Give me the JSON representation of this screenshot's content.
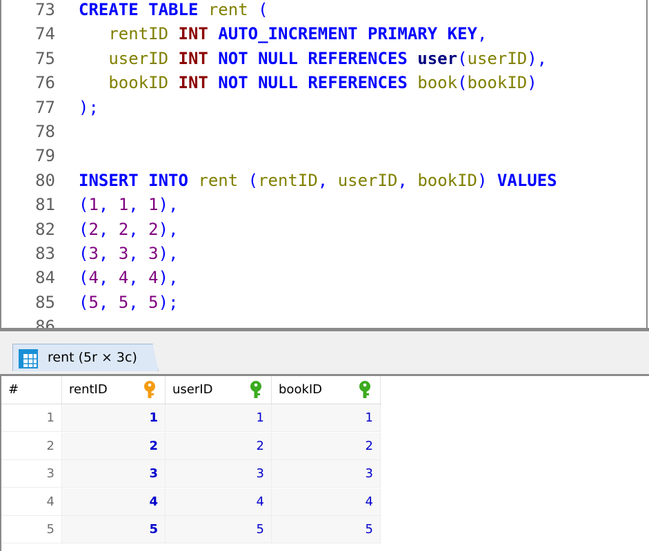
{
  "editor": {
    "lines": [
      {
        "num": "73",
        "tokens": [
          {
            "t": "CREATE TABLE ",
            "c": "kw"
          },
          {
            "t": "rent ",
            "c": "ident"
          },
          {
            "t": "(",
            "c": "sym"
          }
        ]
      },
      {
        "num": "74",
        "tokens": [
          {
            "t": "   rentID ",
            "c": "ident"
          },
          {
            "t": "INT ",
            "c": "kw-type"
          },
          {
            "t": "AUTO_INCREMENT PRIMARY KEY",
            "c": "kw"
          },
          {
            "t": ",",
            "c": "sym"
          }
        ]
      },
      {
        "num": "75",
        "tokens": [
          {
            "t": "   userID ",
            "c": "ident"
          },
          {
            "t": "INT ",
            "c": "kw-type"
          },
          {
            "t": "NOT NULL REFERENCES ",
            "c": "kw"
          },
          {
            "t": "user",
            "c": "fn"
          },
          {
            "t": "(",
            "c": "sym"
          },
          {
            "t": "userID",
            "c": "ident"
          },
          {
            "t": "),",
            "c": "sym"
          }
        ]
      },
      {
        "num": "76",
        "tokens": [
          {
            "t": "   bookID ",
            "c": "ident"
          },
          {
            "t": "INT ",
            "c": "kw-type"
          },
          {
            "t": "NOT NULL REFERENCES ",
            "c": "kw"
          },
          {
            "t": "book",
            "c": "ident"
          },
          {
            "t": "(",
            "c": "sym"
          },
          {
            "t": "bookID",
            "c": "ident"
          },
          {
            "t": ")",
            "c": "sym"
          }
        ]
      },
      {
        "num": "77",
        "tokens": [
          {
            "t": ");",
            "c": "sym"
          }
        ]
      },
      {
        "num": "78",
        "tokens": []
      },
      {
        "num": "79",
        "tokens": []
      },
      {
        "num": "80",
        "tokens": [
          {
            "t": "INSERT INTO ",
            "c": "kw"
          },
          {
            "t": "rent ",
            "c": "ident"
          },
          {
            "t": "(",
            "c": "sym"
          },
          {
            "t": "rentID",
            "c": "ident"
          },
          {
            "t": ", ",
            "c": "sym"
          },
          {
            "t": "userID",
            "c": "ident"
          },
          {
            "t": ", ",
            "c": "sym"
          },
          {
            "t": "bookID",
            "c": "ident"
          },
          {
            "t": ") ",
            "c": "sym"
          },
          {
            "t": "VALUES",
            "c": "kw"
          }
        ]
      },
      {
        "num": "81",
        "tokens": [
          {
            "t": "(",
            "c": "sym"
          },
          {
            "t": "1",
            "c": "num"
          },
          {
            "t": ", ",
            "c": "sym"
          },
          {
            "t": "1",
            "c": "num"
          },
          {
            "t": ", ",
            "c": "sym"
          },
          {
            "t": "1",
            "c": "num"
          },
          {
            "t": "),",
            "c": "sym"
          }
        ]
      },
      {
        "num": "82",
        "tokens": [
          {
            "t": "(",
            "c": "sym"
          },
          {
            "t": "2",
            "c": "num"
          },
          {
            "t": ", ",
            "c": "sym"
          },
          {
            "t": "2",
            "c": "num"
          },
          {
            "t": ", ",
            "c": "sym"
          },
          {
            "t": "2",
            "c": "num"
          },
          {
            "t": "),",
            "c": "sym"
          }
        ]
      },
      {
        "num": "83",
        "tokens": [
          {
            "t": "(",
            "c": "sym"
          },
          {
            "t": "3",
            "c": "num"
          },
          {
            "t": ", ",
            "c": "sym"
          },
          {
            "t": "3",
            "c": "num"
          },
          {
            "t": ", ",
            "c": "sym"
          },
          {
            "t": "3",
            "c": "num"
          },
          {
            "t": "),",
            "c": "sym"
          }
        ]
      },
      {
        "num": "84",
        "tokens": [
          {
            "t": "(",
            "c": "sym"
          },
          {
            "t": "4",
            "c": "num"
          },
          {
            "t": ", ",
            "c": "sym"
          },
          {
            "t": "4",
            "c": "num"
          },
          {
            "t": ", ",
            "c": "sym"
          },
          {
            "t": "4",
            "c": "num"
          },
          {
            "t": "),",
            "c": "sym"
          }
        ]
      },
      {
        "num": "85",
        "tokens": [
          {
            "t": "(",
            "c": "sym"
          },
          {
            "t": "5",
            "c": "num"
          },
          {
            "t": ", ",
            "c": "sym"
          },
          {
            "t": "5",
            "c": "num"
          },
          {
            "t": ", ",
            "c": "sym"
          },
          {
            "t": "5",
            "c": "num"
          },
          {
            "t": ");",
            "c": "sym"
          }
        ]
      },
      {
        "num": "86",
        "tokens": []
      }
    ]
  },
  "result": {
    "tab_label": "rent (5r × 3c)",
    "tab_icon": "table-grid-icon",
    "columns": [
      {
        "label": "#",
        "key": null
      },
      {
        "label": "rentID",
        "key": "primary-key-icon",
        "key_color": "#f39c12"
      },
      {
        "label": "userID",
        "key": "foreign-key-icon",
        "key_color": "#3cab20"
      },
      {
        "label": "bookID",
        "key": "foreign-key-icon",
        "key_color": "#3cab20"
      }
    ],
    "rows": [
      [
        "1",
        "1",
        "1",
        "1"
      ],
      [
        "2",
        "2",
        "2",
        "2"
      ],
      [
        "3",
        "3",
        "3",
        "3"
      ],
      [
        "4",
        "4",
        "4",
        "4"
      ],
      [
        "5",
        "5",
        "5",
        "5"
      ]
    ]
  }
}
